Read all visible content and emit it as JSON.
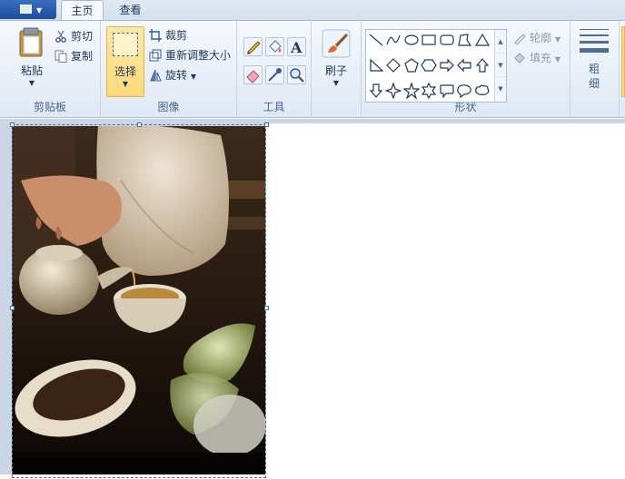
{
  "tabs": [
    {
      "label": "主页",
      "active": true
    },
    {
      "label": "查看",
      "active": false
    }
  ],
  "clipboard": {
    "paste_label": "粘贴",
    "cut_label": "剪切",
    "copy_label": "复制",
    "group_label": "剪贴板"
  },
  "image": {
    "select_label": "选择",
    "crop_label": "裁剪",
    "resize_label": "重新调整大小",
    "rotate_label": "旋转",
    "group_label": "图像"
  },
  "tools": {
    "group_label": "工具",
    "items": [
      "pencil-icon",
      "fill-bucket-icon",
      "text-icon",
      "eraser-icon",
      "color-picker-icon",
      "magnifier-icon"
    ]
  },
  "brushes": {
    "label": "刷子"
  },
  "shapes": {
    "outline_label": "轮廓",
    "fill_label": "填充",
    "group_label": "形状",
    "items": [
      "line-shape-icon",
      "curve-shape-icon",
      "oval-shape-icon",
      "rectangle-shape-icon",
      "rounded-rectangle-shape-icon",
      "polygon-shape-icon",
      "triangle-shape-icon",
      "right-triangle-shape-icon",
      "diamond-shape-icon",
      "pentagon-shape-icon",
      "hexagon-shape-icon",
      "right-arrow-shape-icon",
      "left-arrow-shape-icon",
      "up-arrow-shape-icon",
      "down-arrow-shape-icon",
      "four-point-star-shape-icon",
      "five-point-star-shape-icon",
      "six-point-star-shape-icon",
      "rounded-callout-shape-icon",
      "oval-callout-shape-icon",
      "cloud-callout-shape-icon"
    ]
  },
  "size": {
    "label_top": "粗",
    "label_bottom": "细"
  },
  "colors": {
    "accent": "#3a6fc0",
    "select_highlight": "#fbd97a",
    "ribbon_bg": "#f5f8fc"
  }
}
